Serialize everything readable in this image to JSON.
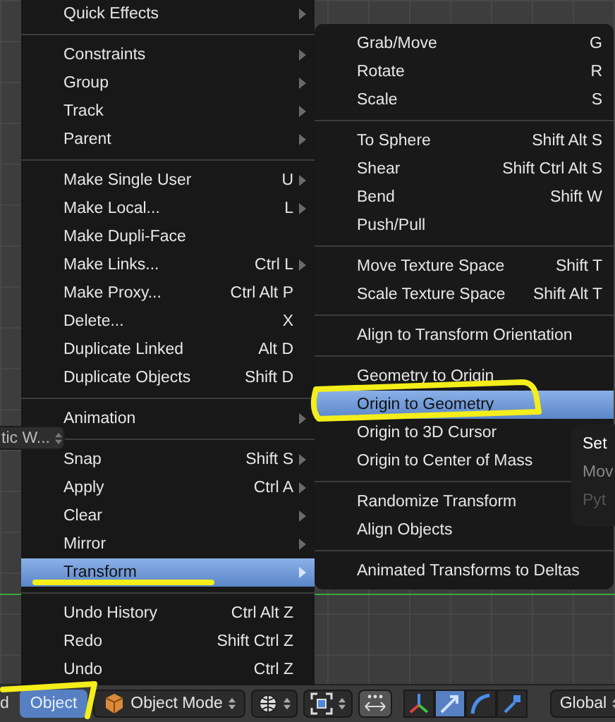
{
  "object_menu": {
    "items": [
      {
        "kind": "item",
        "label": "Quick Effects",
        "submenu": true,
        "selected": false
      },
      {
        "kind": "separator"
      },
      {
        "kind": "item",
        "label": "Constraints",
        "submenu": true,
        "selected": false
      },
      {
        "kind": "item",
        "label": "Group",
        "submenu": true,
        "selected": false
      },
      {
        "kind": "item",
        "label": "Track",
        "submenu": true,
        "selected": false
      },
      {
        "kind": "item",
        "label": "Parent",
        "submenu": true,
        "selected": false
      },
      {
        "kind": "separator"
      },
      {
        "kind": "item",
        "label": "Make Single User",
        "shortcut": "U",
        "submenu": true,
        "selected": false
      },
      {
        "kind": "item",
        "label": "Make Local...",
        "shortcut": "L",
        "submenu": true,
        "selected": false
      },
      {
        "kind": "item",
        "label": "Make Dupli-Face",
        "submenu": false,
        "selected": false
      },
      {
        "kind": "item",
        "label": "Make Links...",
        "shortcut": "Ctrl L",
        "submenu": true,
        "selected": false
      },
      {
        "kind": "item",
        "label": "Make Proxy...",
        "shortcut": "Ctrl Alt P",
        "submenu": false,
        "selected": false
      },
      {
        "kind": "item",
        "label": "Delete...",
        "shortcut": "X",
        "submenu": false,
        "selected": false
      },
      {
        "kind": "item",
        "label": "Duplicate Linked",
        "shortcut": "Alt D",
        "submenu": false,
        "selected": false
      },
      {
        "kind": "item",
        "label": "Duplicate Objects",
        "shortcut": "Shift D",
        "submenu": false,
        "selected": false
      },
      {
        "kind": "separator"
      },
      {
        "kind": "item",
        "label": "Animation",
        "submenu": true,
        "selected": false
      },
      {
        "kind": "separator"
      },
      {
        "kind": "item",
        "label": "Snap",
        "shortcut": "Shift S",
        "submenu": true,
        "selected": false
      },
      {
        "kind": "item",
        "label": "Apply",
        "shortcut": "Ctrl A",
        "submenu": true,
        "selected": false
      },
      {
        "kind": "item",
        "label": "Clear",
        "submenu": true,
        "selected": false
      },
      {
        "kind": "item",
        "label": "Mirror",
        "submenu": true,
        "selected": false
      },
      {
        "kind": "item",
        "label": "Transform",
        "submenu": true,
        "selected": true
      },
      {
        "kind": "separator"
      },
      {
        "kind": "item",
        "label": "Undo History",
        "shortcut": "Ctrl Alt Z",
        "submenu": false,
        "selected": false
      },
      {
        "kind": "item",
        "label": "Redo",
        "shortcut": "Shift Ctrl Z",
        "submenu": false,
        "selected": false
      },
      {
        "kind": "item",
        "label": "Undo",
        "shortcut": "Ctrl Z",
        "submenu": false,
        "selected": false
      }
    ]
  },
  "transform_menu": {
    "items": [
      {
        "kind": "item",
        "label": "Grab/Move",
        "shortcut": "G",
        "selected": false
      },
      {
        "kind": "item",
        "label": "Rotate",
        "shortcut": "R",
        "selected": false
      },
      {
        "kind": "item",
        "label": "Scale",
        "shortcut": "S",
        "selected": false
      },
      {
        "kind": "separator"
      },
      {
        "kind": "item",
        "label": "To Sphere",
        "shortcut": "Shift Alt S",
        "selected": false
      },
      {
        "kind": "item",
        "label": "Shear",
        "shortcut": "Shift Ctrl Alt S",
        "selected": false
      },
      {
        "kind": "item",
        "label": "Bend",
        "shortcut": "Shift W",
        "selected": false
      },
      {
        "kind": "item",
        "label": "Push/Pull",
        "selected": false
      },
      {
        "kind": "separator"
      },
      {
        "kind": "item",
        "label": "Move Texture Space",
        "shortcut": "Shift T",
        "selected": false
      },
      {
        "kind": "item",
        "label": "Scale Texture Space",
        "shortcut": "Shift Alt T",
        "selected": false
      },
      {
        "kind": "separator"
      },
      {
        "kind": "item",
        "label": "Align to Transform Orientation",
        "selected": false
      },
      {
        "kind": "separator"
      },
      {
        "kind": "item",
        "label": "Geometry to Origin",
        "selected": false
      },
      {
        "kind": "item",
        "label": "Origin to Geometry",
        "selected": true
      },
      {
        "kind": "item",
        "label": "Origin to 3D Cursor",
        "selected": false
      },
      {
        "kind": "item",
        "label": "Origin to Center of Mass",
        "selected": false
      },
      {
        "kind": "separator"
      },
      {
        "kind": "item",
        "label": "Randomize Transform",
        "selected": false
      },
      {
        "kind": "item",
        "label": "Align Objects",
        "selected": false
      },
      {
        "kind": "separator"
      },
      {
        "kind": "item",
        "label": "Animated Transforms to Deltas",
        "selected": false
      }
    ]
  },
  "tooltip": {
    "lines": [
      {
        "text": "Set",
        "kind": "title"
      },
      {
        "text": "Mov",
        "kind": "description"
      },
      {
        "text": "Pyt",
        "kind": "python"
      }
    ]
  },
  "side_field": {
    "value": "tic W..."
  },
  "header": {
    "edge_text": "d",
    "menus": [
      {
        "label": "Object",
        "selected": true
      }
    ],
    "mode_dropdown": {
      "value": "Object Mode"
    },
    "orientation_dropdown": {
      "value": "Global"
    },
    "manipulators": [
      {
        "kind": "axes",
        "selected": false
      },
      {
        "kind": "translate",
        "selected": true
      },
      {
        "kind": "rotate",
        "selected": false
      },
      {
        "kind": "scale",
        "selected": false
      }
    ]
  }
}
